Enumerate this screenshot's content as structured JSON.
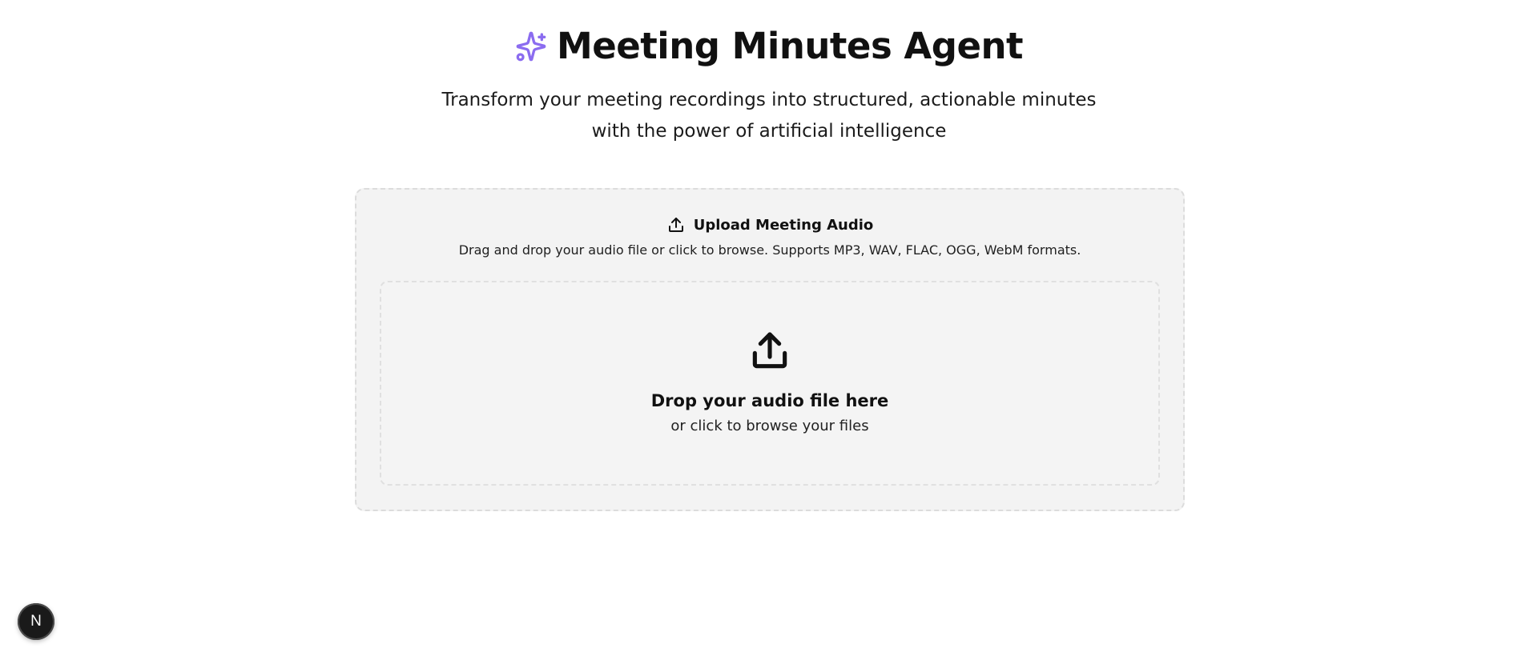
{
  "header": {
    "title": "Meeting Minutes Agent",
    "subtitle": "Transform your meeting recordings into structured, actionable minutes with the power of artificial intelligence",
    "icon": "sparkles-icon",
    "accent_color": "#8b6cf0"
  },
  "upload_card": {
    "title": "Upload Meeting Audio",
    "title_icon": "upload-icon",
    "description": "Drag and drop your audio file or click to browse. Supports MP3, WAV, FLAC, OGG, WebM formats.",
    "dropzone": {
      "icon": "upload-icon",
      "title": "Drop your audio file here",
      "subtitle": "or click to browse your files"
    }
  },
  "dev_badge": {
    "label": "N",
    "icon": "nextjs-icon"
  }
}
